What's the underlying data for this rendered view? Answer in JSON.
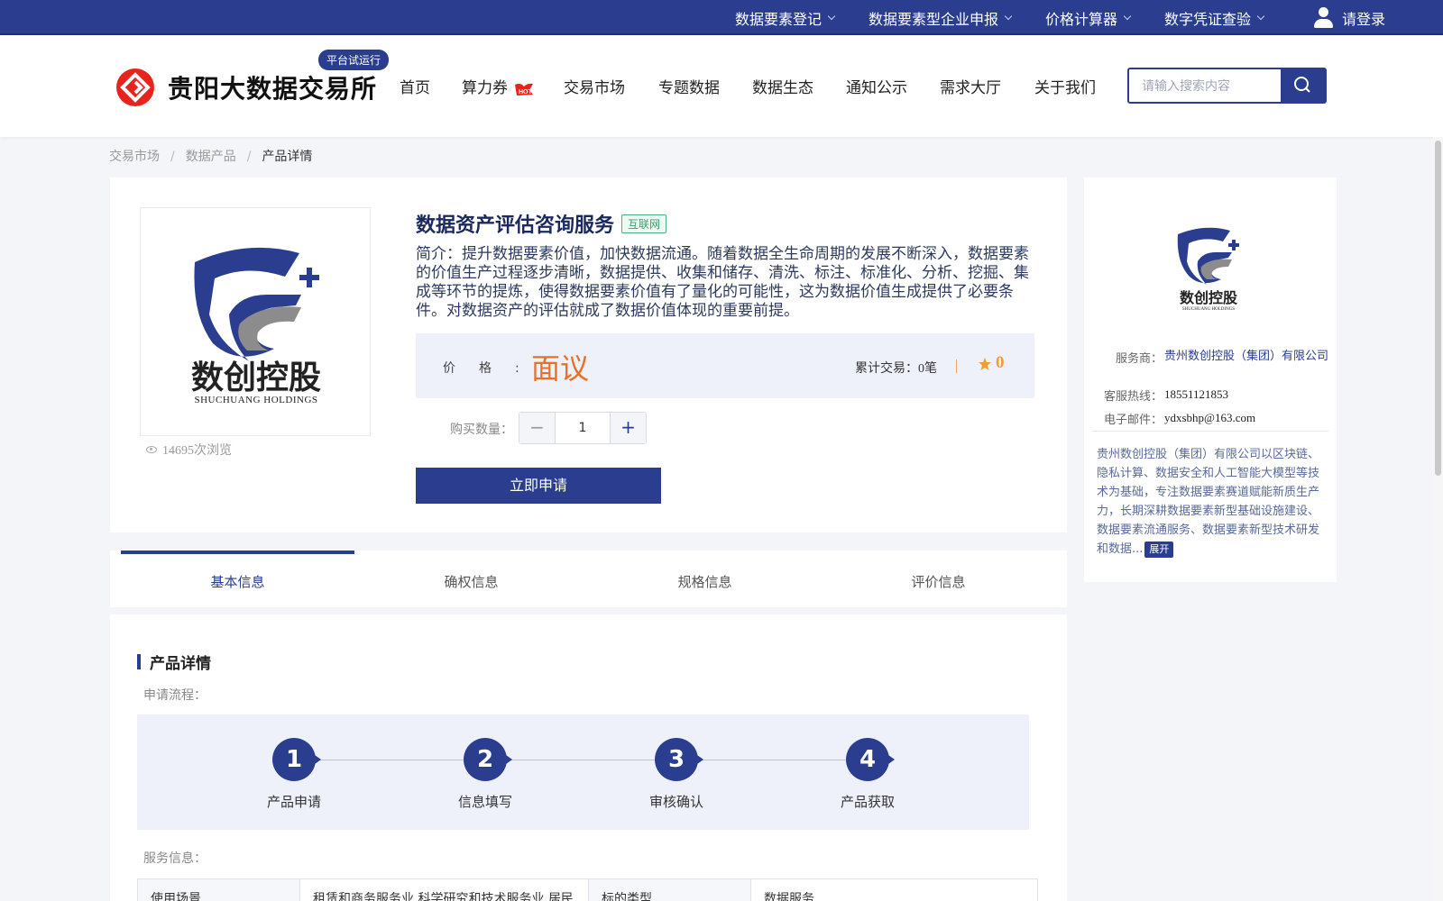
{
  "topbar": {
    "items": [
      "数据要素登记",
      "数据要素型企业申报",
      "价格计算器",
      "数字凭证查验"
    ],
    "login": "请登录"
  },
  "header": {
    "brand": "贵阳大数据交易所",
    "trial_badge": "平台试运行",
    "nav": [
      "首页",
      "算力券",
      "交易市场",
      "专题数据",
      "数据生态",
      "通知公示",
      "需求大厅",
      "关于我们"
    ],
    "search_placeholder": "请输入搜索内容"
  },
  "breadcrumb": [
    "交易市场",
    "数据产品",
    "产品详情"
  ],
  "product": {
    "title": "数据资产评估咨询服务",
    "tag": "互联网",
    "description": "简介：提升数据要素价值，加快数据流通。随着数据全生命周期的发展不断深入，数据要素的价值生产过程逐步清晰，数据提供、收集和储存、清洗、标注、标准化、分析、挖掘、集成等环节的提炼，使得数据要素价值有了量化的可能性，这为数据价值生成提供了必要条件。对数据资产的评估就成了数据价值体现的重要前提。",
    "image_logo_cn": "数创控股",
    "image_logo_en": "SHUCHUANG HOLDINGS",
    "views": "14695次浏览",
    "price_label": "价格:",
    "price": "面议",
    "trades": "累计交易：0笔",
    "rating": "0",
    "qty_label": "购买数量：",
    "qty": "1",
    "apply": "立即申请"
  },
  "tabs": [
    "基本信息",
    "确权信息",
    "规格信息",
    "评价信息"
  ],
  "detail": {
    "section_title": "产品详情",
    "flow_label": "申请流程：",
    "steps": [
      {
        "num": "1",
        "label": "产品申请"
      },
      {
        "num": "2",
        "label": "信息填写"
      },
      {
        "num": "3",
        "label": "审核确认"
      },
      {
        "num": "4",
        "label": "产品获取"
      }
    ],
    "service_label": "服务信息：",
    "table_row": [
      "使用场景",
      "租赁和商务服务业,科学研究和技术服务业,居民",
      "标的类型",
      "数据服务"
    ]
  },
  "provider": {
    "logo_cn": "数创控股",
    "logo_en": "SHUCHUANG HOLDINGS",
    "provider_key": "服务商：",
    "provider_val": "贵州数创控股（集团）有限公司",
    "hotline_key": "客服热线：",
    "hotline_val": "18551121853",
    "email_key": "电子邮件：",
    "email_val": "ydxsbhp@163.com",
    "description": "贵州数创控股（集团）有限公司以区块链、隐私计算、数据安全和人工智能大模型等技术为基础，专注数据要素赛道赋能新质生产力，长期深耕数据要素新型基础设施建设、数据要素流通服务、数据要素新型技术研发和数据...",
    "expand": "展开"
  },
  "colors": {
    "primary": "#2a3d8f",
    "accent_price": "#e8712a",
    "star": "#f0a030",
    "hot": "#e8231e"
  }
}
